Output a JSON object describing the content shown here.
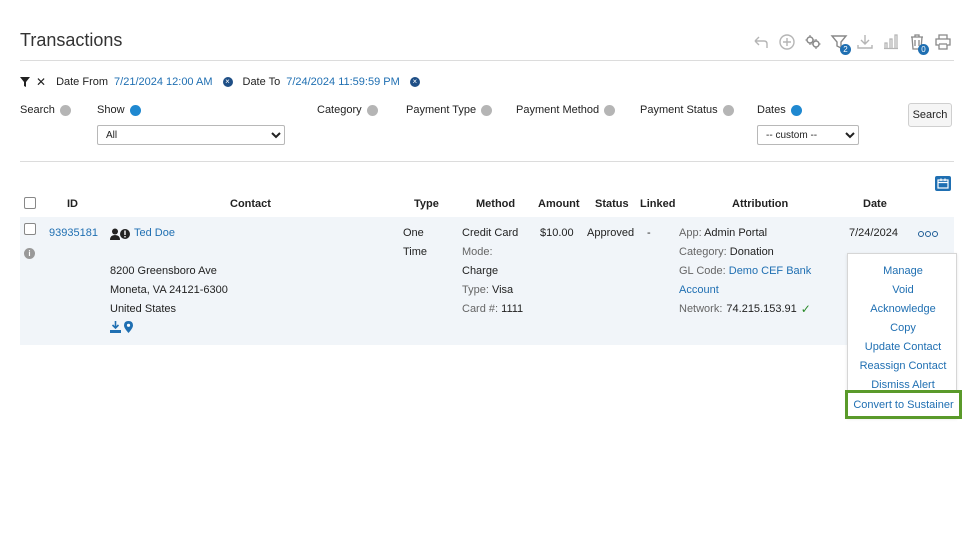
{
  "page": {
    "title": "Transactions"
  },
  "toolbar": {
    "icons": [
      {
        "name": "undo-icon"
      },
      {
        "name": "add-icon"
      },
      {
        "name": "settings-icon"
      },
      {
        "name": "filter-icon",
        "badge": "2"
      },
      {
        "name": "download-icon"
      },
      {
        "name": "chart-icon"
      },
      {
        "name": "trash-icon",
        "badge": "0"
      },
      {
        "name": "print-icon"
      }
    ]
  },
  "filters": {
    "date_from_label": "Date From",
    "date_from_value": "7/21/2024 12:00 AM",
    "date_to_label": "Date To",
    "date_to_value": "7/24/2024 11:59:59 PM"
  },
  "facets": {
    "search": "Search",
    "show": "Show",
    "show_value": "All",
    "category": "Category",
    "payment_type": "Payment Type",
    "payment_method": "Payment Method",
    "payment_status": "Payment Status",
    "dates": "Dates",
    "dates_value": "-- custom --",
    "search_button": "Search"
  },
  "table": {
    "headers": {
      "id": "ID",
      "contact": "Contact",
      "type": "Type",
      "method": "Method",
      "amount": "Amount",
      "status": "Status",
      "linked": "Linked",
      "attribution": "Attribution",
      "date": "Date"
    },
    "row": {
      "id": "93935181",
      "contact_name": "Ted Doe",
      "address1": "8200 Greensboro Ave",
      "address2": "Moneta, VA 24121-6300",
      "address3": "United States",
      "type_line1": "One",
      "type_line2": "Time",
      "method": "Credit Card",
      "mode_label": "Mode:",
      "mode_value": "Charge",
      "type_label": "Type:",
      "type_value": "Visa",
      "card_label": "Card #:",
      "card_value": "1111",
      "amount": "$10.00",
      "status": "Approved",
      "linked": "-",
      "app_label": "App:",
      "app_value": "Admin Portal",
      "category_label": "Category:",
      "category_value": "Donation",
      "gl_label": "GL Code:",
      "gl_value_1": "Demo CEF Bank",
      "gl_value_2": "Account",
      "network_label": "Network:",
      "network_value": "74.215.153.91",
      "date": "7/24/2024"
    }
  },
  "menu": {
    "items": [
      "Manage",
      "Void",
      "Acknowledge",
      "Copy",
      "Update Contact",
      "Reassign Contact",
      "Dismiss Alert",
      "Convert to Sustainer"
    ]
  },
  "colors": {
    "link": "#1f6fb2",
    "highlight": "#5a9a2a",
    "row_bg": "#f1f5f9"
  }
}
